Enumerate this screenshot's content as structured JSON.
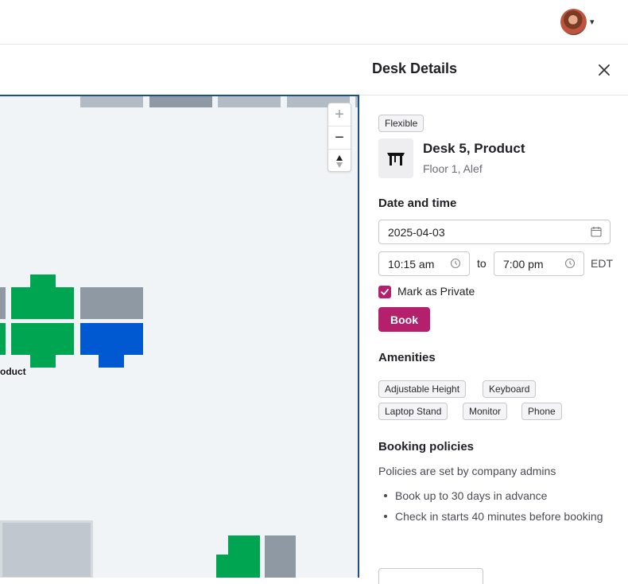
{
  "header": {
    "avatar_menu_icon": "chevron-down-icon"
  },
  "map": {
    "label": "oduct",
    "zoom_in": "+",
    "zoom_out": "−",
    "compass": "⇕",
    "desk_colors": {
      "available": "#00a551",
      "selected": "#0059d1",
      "unavailable": "#8e99a4",
      "light": "#b3bcc4"
    }
  },
  "panel": {
    "title": "Desk Details",
    "desk": {
      "tag": "Flexible",
      "name": "Desk 5, Product",
      "location": "Floor 1, Alef"
    },
    "date_time": {
      "heading": "Date and time",
      "date": "2025-04-03",
      "start": "10:15 am",
      "to_label": "to",
      "end": "7:00 pm",
      "timezone": "EDT"
    },
    "private": {
      "label": "Mark as Private",
      "checked": true
    },
    "book_label": "Book",
    "amenities": {
      "heading": "Amenities",
      "items": [
        "Adjustable Height",
        "Keyboard",
        "Laptop Stand",
        "Monitor",
        "Phone"
      ]
    },
    "policies": {
      "heading": "Booking policies",
      "subtitle": "Policies are set by company admins",
      "items": [
        "Book up to 30 days in advance",
        "Check in starts 40 minutes before booking"
      ]
    }
  },
  "colors": {
    "accent": "#b5206d",
    "map_border": "#1c4f8c"
  }
}
